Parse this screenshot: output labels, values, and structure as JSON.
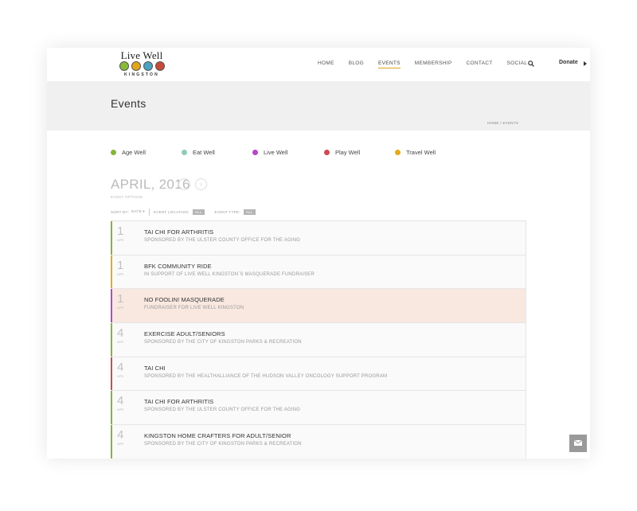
{
  "header": {
    "logo_title": "Live Well",
    "logo_sub": "KINGSTON",
    "logo_colors": [
      "#8ab93a",
      "#e4a51b",
      "#4aa3c0",
      "#c74a3b"
    ],
    "nav": [
      "HOME",
      "BLOG",
      "EVENTS",
      "MEMBERSHIP",
      "CONTACT",
      "SOCIAL"
    ],
    "active_nav": "EVENTS",
    "donate_label": "Donate"
  },
  "band": {
    "title": "Events",
    "breadcrumb": "HOME / EVENTS"
  },
  "legend": [
    {
      "label": "Age Well",
      "color": "#86b43a"
    },
    {
      "label": "Eat Well",
      "color": "#8fcbb7"
    },
    {
      "label": "Live Well",
      "color": "#b746c8"
    },
    {
      "label": "Play Well",
      "color": "#cc4a52"
    },
    {
      "label": "Travel Well",
      "color": "#e4aa1e"
    }
  ],
  "month": {
    "label": "APRIL, 2016",
    "prev": "‹",
    "next": "›",
    "sub": "EVENT OPTIONS"
  },
  "filter": {
    "sort_label": "SORT BY:",
    "sort_value": "DATE ▾",
    "location_label": "EVENT LOCATION:",
    "location_value": "ALL",
    "type_label": "EVENT TYPE:",
    "type_value": "ALL"
  },
  "events": [
    {
      "day": "1",
      "mon": "APR",
      "name": "TAI CHI FOR ARTHRITIS",
      "sub": "SPONSORED BY THE ULSTER COUNTY OFFICE FOR THE AGING",
      "color": "#86b43a",
      "highlight": false
    },
    {
      "day": "1",
      "mon": "APR",
      "name": "BFK COMMUNITY RIDE",
      "sub": "IN SUPPORT OF LIVE WELL KINGSTON`S MASQUERADE FUNDRAISER",
      "color": "#e4aa1e",
      "highlight": false
    },
    {
      "day": "1",
      "mon": "APR",
      "name": "NO FOOLIN! MASQUERADE",
      "sub": "FUNDRAISER FOR LIVE WELL KINGSTON",
      "color": "#b746c8",
      "highlight": true
    },
    {
      "day": "4",
      "mon": "APR",
      "name": "EXERCISE ADULT/SENIORS",
      "sub": "SPONSORED BY THE CITY OF KINGSTON PARKS & RECREATION",
      "color": "#86b43a",
      "highlight": false
    },
    {
      "day": "4",
      "mon": "APR",
      "name": "TAI CHI",
      "sub": "SPONSORED BY THE HEALTHALLIANCE OF THE HUDSON VALLEY ONCOLOGY SUPPORT PROGRAM",
      "color": "#cc4a52",
      "highlight": false
    },
    {
      "day": "4",
      "mon": "APR",
      "name": "TAI CHI FOR ARTHRITIS",
      "sub": "SPONSORED BY THE ULSTER COUNTY OFFICE FOR THE AGING",
      "color": "#86b43a",
      "highlight": false
    },
    {
      "day": "4",
      "mon": "APR",
      "name": "KINGSTON HOME CRAFTERS FOR ADULT/SENIOR",
      "sub": "SPONSORED BY THE CITY OF KINGSTON PARKS & RECREATION",
      "color": "#86b43a",
      "highlight": false
    }
  ]
}
